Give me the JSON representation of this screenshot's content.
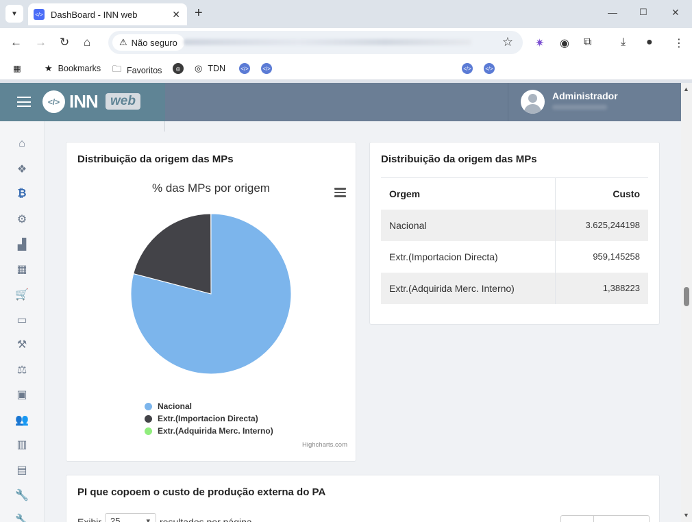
{
  "browser": {
    "tab_title": "DashBoard - INN web",
    "security_label": "Não seguro",
    "bookmarks": [
      "Bookmarks",
      "Favoritos",
      "TDN"
    ]
  },
  "app": {
    "logo_text": "INN",
    "logo_badge": "web",
    "user_name": "Administrador"
  },
  "sidebar": {
    "items": [
      "home",
      "cubes",
      "bitcoin",
      "cogs",
      "industry",
      "calculator",
      "cart",
      "wallet",
      "gavel",
      "balance-scale",
      "money",
      "users",
      "bar-chart",
      "document",
      "wrench",
      "wrench-2"
    ],
    "active": "bitcoin"
  },
  "chart_card": {
    "title": "Distribuição da origem das MPs",
    "credits": "Highcharts.com"
  },
  "chart_data": {
    "type": "pie",
    "title": "% das MPs por origem",
    "series": [
      {
        "name": "Nacional",
        "value": 3625.244198,
        "color": "#7cb5ec"
      },
      {
        "name": "Extr.(Importacion Directa)",
        "value": 959.145258,
        "color": "#434348"
      },
      {
        "name": "Extr.(Adquirida Merc. Interno)",
        "value": 1.388223,
        "color": "#90ed7d"
      }
    ],
    "legend_position": "bottom"
  },
  "table_card": {
    "title": "Distribuição da origem das MPs",
    "columns": [
      "Orgem",
      "Custo"
    ],
    "rows": [
      [
        "Nacional",
        "3.625,244198"
      ],
      [
        "Extr.(Importacion Directa)",
        "959,145258"
      ],
      [
        "Extr.(Adquirida Merc. Interno)",
        "1,388223"
      ]
    ]
  },
  "pi_card": {
    "title": "PI que copoem o custo de produção externa do PA",
    "show_label": "Exibir",
    "page_length": "25",
    "per_page_label": "resultados por página"
  }
}
